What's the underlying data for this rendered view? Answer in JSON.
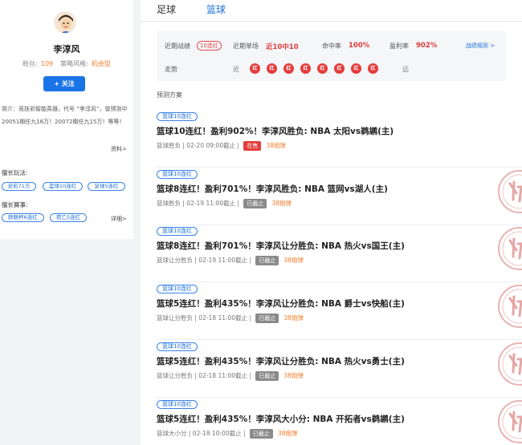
{
  "profile": {
    "name": "李淳风",
    "fans_label": "粉丝:",
    "fans_value": "109",
    "style_label": "策略风格:",
    "style_value": "机会型",
    "follow_label": "+ 关注",
    "bio": "简介：竞技彩智能英雄，代号 “李淳风”，曾预测中20051期任九16万！20072期任九15万！等等！",
    "bio_more": "资料>",
    "skills_label": "擅长玩法:",
    "skills": [
      "足彩71万",
      "篮球10连红",
      "足球5连红"
    ],
    "events_label": "擅长赛事:",
    "events": [
      "欧联杯6连红",
      "荷乙5连红"
    ],
    "events_more": "详细>"
  },
  "tabs": [
    "足球",
    "篮球"
  ],
  "summary": {
    "recent_label": "近期战绩",
    "recent_badge": "10连红",
    "single_label": "近期单场",
    "single_value": "近10中10",
    "hit_label": "命中率",
    "hit_value": "100%",
    "profit_label": "盈利率",
    "profit_value": "902%",
    "rule_link": "战绩规则 >",
    "trend_label": "走势",
    "near": "近",
    "far": "远",
    "trend": [
      "红",
      "红",
      "红",
      "红",
      "红",
      "红",
      "红",
      "红",
      "红"
    ]
  },
  "plan_title": "预测方案",
  "items": [
    {
      "tag": "篮球10连红",
      "title": "篮球10连红！盈利902%！李淳风胜负: NBA 太阳vs鹈鹕(主)",
      "type": "篮球胜负",
      "time": "02-20 09:00截止",
      "status": "在售",
      "price": "38炮弹",
      "stamp": false
    },
    {
      "tag": "篮球10连红",
      "title": "篮球8连红！盈利701%！李淳风胜负: NBA 篮网vs湖人(主)",
      "type": "篮球胜负",
      "time": "02-19 11:00截止",
      "status": "已截止",
      "price": "38炮弹",
      "stamp": true
    },
    {
      "tag": "篮球10连红",
      "title": "篮球8连红！盈利701%！李淳风让分胜负: NBA 热火vs国王(主)",
      "type": "篮球让分胜负",
      "time": "02-19 11:00截止",
      "status": "已截止",
      "price": "38炮弹",
      "stamp": true
    },
    {
      "tag": "篮球10连红",
      "title": "篮球5连红！盈利435%！李淳风让分胜负: NBA 爵士vs快船(主)",
      "type": "篮球让分胜负",
      "time": "02-18 11:00截止",
      "status": "已截止",
      "price": "38炮弹",
      "stamp": true
    },
    {
      "tag": "篮球10连红",
      "title": "篮球5连红！盈利435%！李淳风让分胜负: NBA 热火vs勇士(主)",
      "type": "篮球让分胜负",
      "time": "02-18 11:00截止",
      "status": "已截止",
      "price": "38炮弹",
      "stamp": true
    },
    {
      "tag": "篮球10连红",
      "title": "篮球5连红！盈利435%！李淳风大小分: NBA 开拓者vs鹈鹕(主)",
      "type": "篮球大小分",
      "time": "02-18 10:00截止",
      "status": "已截止",
      "price": "38炮弹",
      "stamp": true
    }
  ],
  "colors": {
    "accent": "#1a74e8",
    "red": "#e43c3c",
    "orange": "#f57c2b"
  }
}
